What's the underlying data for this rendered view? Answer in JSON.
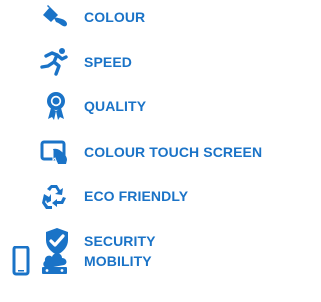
{
  "features": [
    {
      "label": "COLOUR",
      "icon": "paint-bucket-icon"
    },
    {
      "label": "SPEED",
      "icon": "running-person-icon"
    },
    {
      "label": "QUALITY",
      "icon": "award-ribbon-icon"
    },
    {
      "label": "COLOUR TOUCH SCREEN",
      "icon": "touch-screen-icon"
    },
    {
      "label": "ECO FRIENDLY",
      "icon": "recycle-icon"
    },
    {
      "label": "SECURITY",
      "icon": "shield-check-icon"
    },
    {
      "label": "MOBILITY",
      "icon": "phone-cloud-icon"
    }
  ],
  "colors": {
    "accent": "#1a73c7"
  }
}
